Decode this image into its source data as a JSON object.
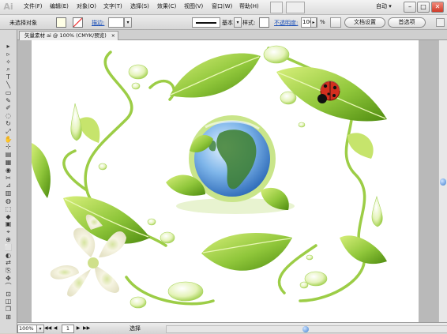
{
  "app": {
    "logo": "Ai",
    "workspace": "自动 ▾"
  },
  "menu": [
    "文件(F)",
    "编辑(E)",
    "对象(O)",
    "文字(T)",
    "选择(S)",
    "效果(C)",
    "视图(V)",
    "窗口(W)",
    "帮助(H)"
  ],
  "window_buttons": {
    "minimize": "–",
    "maximize": "□",
    "close": "✕"
  },
  "control": {
    "selection_state": "未选择对象",
    "stroke_label": "描边:",
    "brush_label": "基本",
    "style_label": "样式:",
    "opacity_label": "不透明度:",
    "opacity_value": "100",
    "opacity_unit": "%",
    "doc_setup_button": "文档设置",
    "preferences_button": "首选项"
  },
  "document_tab": {
    "title": "矢量素材  ai @ 100% (CMYK/预览)",
    "close": "×"
  },
  "tools": [
    "▸",
    "▹",
    "✧",
    "⌕",
    "T",
    "╲",
    "▭",
    "✎",
    "✐",
    "◌",
    "↻",
    "⤢",
    "✋",
    "⊹",
    "▤",
    "▦",
    "◉",
    "✂",
    "⊿",
    "▥",
    "◍",
    "⬚",
    "◆",
    "▣",
    "⌖",
    "⊕",
    "⬜",
    "◐",
    "⇄",
    "⎘",
    "✥",
    "⌒",
    "⊡",
    "◫",
    "❐",
    "⊞"
  ],
  "status": {
    "zoom": "100%",
    "first": "◀◀",
    "prev": "◀",
    "page": "1",
    "next": "▶",
    "last": "▶▶",
    "label": "选择"
  },
  "colors": {
    "leaf_dark": "#5c9a12",
    "leaf_light": "#c4e566",
    "vine": "#8cc63f",
    "ocean": "#4a8fd4",
    "land": "#3a7b2a",
    "ladybug": "#d32f1f",
    "flower": "#f3f1dc"
  }
}
